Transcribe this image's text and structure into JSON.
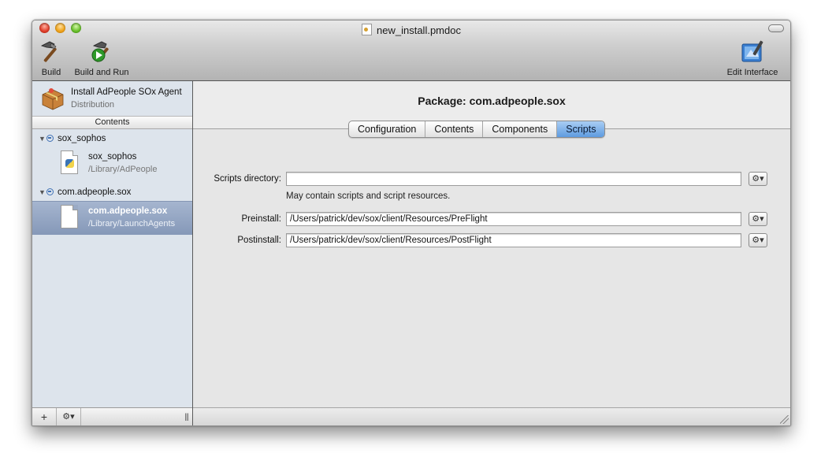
{
  "window": {
    "title": "new_install.pmdoc"
  },
  "toolbar": {
    "build_label": "Build",
    "build_run_label": "Build and Run",
    "edit_interface_label": "Edit Interface"
  },
  "sidebar": {
    "title": "Install AdPeople SOx Agent",
    "subtitle": "Distribution",
    "section_header": "Contents",
    "groups": [
      {
        "label": "sox_sophos",
        "items": [
          {
            "name": "sox_sophos",
            "path": "/Library/AdPeople",
            "icon": "python-file-icon"
          }
        ]
      },
      {
        "label": "com.adpeople.sox",
        "items": [
          {
            "name": "com.adpeople.sox",
            "path": "/Library/LaunchAgents",
            "icon": "file-icon",
            "selected": true
          }
        ]
      }
    ],
    "bottom": {
      "add": "+",
      "action": "⚙▾"
    }
  },
  "main": {
    "package_title": "Package: com.adpeople.sox",
    "tabs": [
      {
        "label": "Configuration",
        "active": false
      },
      {
        "label": "Contents",
        "active": false
      },
      {
        "label": "Components",
        "active": false
      },
      {
        "label": "Scripts",
        "active": true
      }
    ],
    "fields": {
      "scripts_directory": {
        "label": "Scripts directory:",
        "value": "",
        "hint": "May contain scripts and script resources."
      },
      "preinstall": {
        "label": "Preinstall:",
        "value": "/Users/patrick/dev/sox/client/Resources/PreFlight"
      },
      "postinstall": {
        "label": "Postinstall:",
        "value": "/Users/patrick/dev/sox/client/Resources/PostFlight"
      }
    },
    "gear_label": "⚙▾"
  },
  "colors": {
    "selection": "#8598b8",
    "active_tab": "#5e9be0",
    "sidebar_bg": "#dde4ec"
  }
}
